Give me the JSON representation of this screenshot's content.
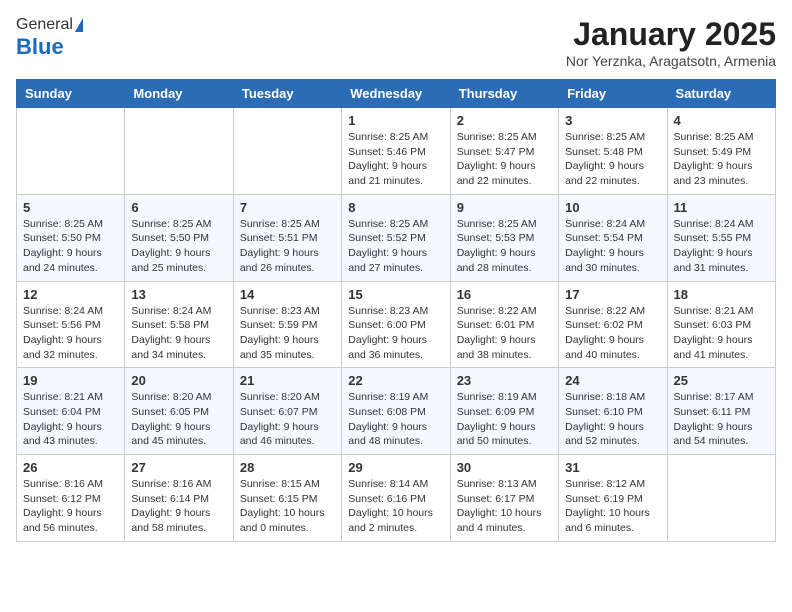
{
  "header": {
    "logo_general": "General",
    "logo_blue": "Blue",
    "month_title": "January 2025",
    "location": "Nor Yerznka, Aragatsotn, Armenia"
  },
  "days_of_week": [
    "Sunday",
    "Monday",
    "Tuesday",
    "Wednesday",
    "Thursday",
    "Friday",
    "Saturday"
  ],
  "weeks": [
    [
      {
        "day": "",
        "detail": ""
      },
      {
        "day": "",
        "detail": ""
      },
      {
        "day": "",
        "detail": ""
      },
      {
        "day": "1",
        "detail": "Sunrise: 8:25 AM\nSunset: 5:46 PM\nDaylight: 9 hours\nand 21 minutes."
      },
      {
        "day": "2",
        "detail": "Sunrise: 8:25 AM\nSunset: 5:47 PM\nDaylight: 9 hours\nand 22 minutes."
      },
      {
        "day": "3",
        "detail": "Sunrise: 8:25 AM\nSunset: 5:48 PM\nDaylight: 9 hours\nand 22 minutes."
      },
      {
        "day": "4",
        "detail": "Sunrise: 8:25 AM\nSunset: 5:49 PM\nDaylight: 9 hours\nand 23 minutes."
      }
    ],
    [
      {
        "day": "5",
        "detail": "Sunrise: 8:25 AM\nSunset: 5:50 PM\nDaylight: 9 hours\nand 24 minutes."
      },
      {
        "day": "6",
        "detail": "Sunrise: 8:25 AM\nSunset: 5:50 PM\nDaylight: 9 hours\nand 25 minutes."
      },
      {
        "day": "7",
        "detail": "Sunrise: 8:25 AM\nSunset: 5:51 PM\nDaylight: 9 hours\nand 26 minutes."
      },
      {
        "day": "8",
        "detail": "Sunrise: 8:25 AM\nSunset: 5:52 PM\nDaylight: 9 hours\nand 27 minutes."
      },
      {
        "day": "9",
        "detail": "Sunrise: 8:25 AM\nSunset: 5:53 PM\nDaylight: 9 hours\nand 28 minutes."
      },
      {
        "day": "10",
        "detail": "Sunrise: 8:24 AM\nSunset: 5:54 PM\nDaylight: 9 hours\nand 30 minutes."
      },
      {
        "day": "11",
        "detail": "Sunrise: 8:24 AM\nSunset: 5:55 PM\nDaylight: 9 hours\nand 31 minutes."
      }
    ],
    [
      {
        "day": "12",
        "detail": "Sunrise: 8:24 AM\nSunset: 5:56 PM\nDaylight: 9 hours\nand 32 minutes."
      },
      {
        "day": "13",
        "detail": "Sunrise: 8:24 AM\nSunset: 5:58 PM\nDaylight: 9 hours\nand 34 minutes."
      },
      {
        "day": "14",
        "detail": "Sunrise: 8:23 AM\nSunset: 5:59 PM\nDaylight: 9 hours\nand 35 minutes."
      },
      {
        "day": "15",
        "detail": "Sunrise: 8:23 AM\nSunset: 6:00 PM\nDaylight: 9 hours\nand 36 minutes."
      },
      {
        "day": "16",
        "detail": "Sunrise: 8:22 AM\nSunset: 6:01 PM\nDaylight: 9 hours\nand 38 minutes."
      },
      {
        "day": "17",
        "detail": "Sunrise: 8:22 AM\nSunset: 6:02 PM\nDaylight: 9 hours\nand 40 minutes."
      },
      {
        "day": "18",
        "detail": "Sunrise: 8:21 AM\nSunset: 6:03 PM\nDaylight: 9 hours\nand 41 minutes."
      }
    ],
    [
      {
        "day": "19",
        "detail": "Sunrise: 8:21 AM\nSunset: 6:04 PM\nDaylight: 9 hours\nand 43 minutes."
      },
      {
        "day": "20",
        "detail": "Sunrise: 8:20 AM\nSunset: 6:05 PM\nDaylight: 9 hours\nand 45 minutes."
      },
      {
        "day": "21",
        "detail": "Sunrise: 8:20 AM\nSunset: 6:07 PM\nDaylight: 9 hours\nand 46 minutes."
      },
      {
        "day": "22",
        "detail": "Sunrise: 8:19 AM\nSunset: 6:08 PM\nDaylight: 9 hours\nand 48 minutes."
      },
      {
        "day": "23",
        "detail": "Sunrise: 8:19 AM\nSunset: 6:09 PM\nDaylight: 9 hours\nand 50 minutes."
      },
      {
        "day": "24",
        "detail": "Sunrise: 8:18 AM\nSunset: 6:10 PM\nDaylight: 9 hours\nand 52 minutes."
      },
      {
        "day": "25",
        "detail": "Sunrise: 8:17 AM\nSunset: 6:11 PM\nDaylight: 9 hours\nand 54 minutes."
      }
    ],
    [
      {
        "day": "26",
        "detail": "Sunrise: 8:16 AM\nSunset: 6:12 PM\nDaylight: 9 hours\nand 56 minutes."
      },
      {
        "day": "27",
        "detail": "Sunrise: 8:16 AM\nSunset: 6:14 PM\nDaylight: 9 hours\nand 58 minutes."
      },
      {
        "day": "28",
        "detail": "Sunrise: 8:15 AM\nSunset: 6:15 PM\nDaylight: 10 hours\nand 0 minutes."
      },
      {
        "day": "29",
        "detail": "Sunrise: 8:14 AM\nSunset: 6:16 PM\nDaylight: 10 hours\nand 2 minutes."
      },
      {
        "day": "30",
        "detail": "Sunrise: 8:13 AM\nSunset: 6:17 PM\nDaylight: 10 hours\nand 4 minutes."
      },
      {
        "day": "31",
        "detail": "Sunrise: 8:12 AM\nSunset: 6:19 PM\nDaylight: 10 hours\nand 6 minutes."
      },
      {
        "day": "",
        "detail": ""
      }
    ]
  ]
}
